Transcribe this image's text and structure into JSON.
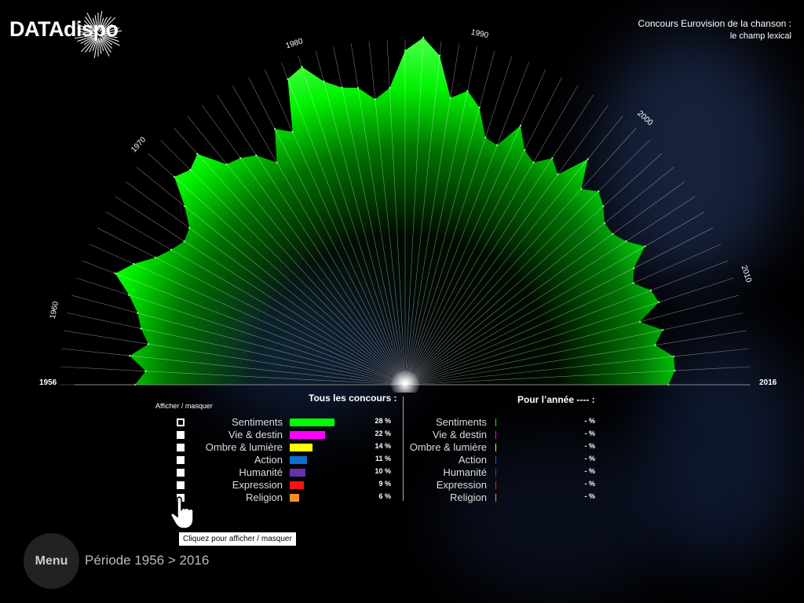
{
  "brand": "DATAdispo",
  "header": {
    "title": "Concours Eurovision de la chanson :",
    "subtitle": "le champ lexical"
  },
  "legend": {
    "toggle_heading": "Afficher / masquer",
    "all_heading": "Tous les concours :",
    "year_heading": "Pour l’année ---- :",
    "tooltip": "Cliquez pour afficher / masquer",
    "categories": [
      {
        "label": "Sentiments",
        "pct": "28 %",
        "value": 28,
        "color": "#00ff00",
        "year_pct": "- %"
      },
      {
        "label": "Vie & destin",
        "pct": "22 %",
        "value": 22,
        "color": "#ff00ff",
        "year_pct": "- %"
      },
      {
        "label": "Ombre & lumière",
        "pct": "14 %",
        "value": 14,
        "color": "#ffff00",
        "year_pct": "- %"
      },
      {
        "label": "Action",
        "pct": "11 %",
        "value": 11,
        "color": "#0a6fd1",
        "year_pct": "- %"
      },
      {
        "label": "Humanité",
        "pct": "10 %",
        "value": 10,
        "color": "#6a2fb0",
        "year_pct": "- %"
      },
      {
        "label": "Expression",
        "pct": "9 %",
        "value": 9,
        "color": "#ff1010",
        "year_pct": "- %"
      },
      {
        "label": "Religion",
        "pct": "6 %",
        "value": 6,
        "color": "#ff9020",
        "year_pct": "- %"
      }
    ]
  },
  "footer": {
    "menu_label": "Menu",
    "period": "Période 1956 > 2016"
  },
  "chart_data": {
    "type": "area",
    "layout": "radial-half",
    "series": [
      {
        "color": "#00ff00"
      }
    ],
    "year_range": [
      1956,
      2016
    ],
    "tick_labels": [
      "1956",
      "1960",
      "1970",
      "1980",
      "1990",
      "2000",
      "2010",
      "2016"
    ],
    "tick_years": [
      1956,
      1960,
      1970,
      1980,
      1990,
      2000,
      2010,
      2016
    ],
    "x": [
      1956,
      1957,
      1958,
      1959,
      1960,
      1961,
      1962,
      1963,
      1964,
      1965,
      1966,
      1967,
      1968,
      1969,
      1970,
      1971,
      1972,
      1973,
      1974,
      1975,
      1976,
      1977,
      1978,
      1979,
      1980,
      1981,
      1982,
      1983,
      1984,
      1985,
      1986,
      1987,
      1988,
      1989,
      1990,
      1991,
      1992,
      1993,
      1994,
      1995,
      1996,
      1997,
      1998,
      1999,
      2000,
      2001,
      2002,
      2003,
      2004,
      2005,
      2006,
      2007,
      2008,
      2009,
      2010,
      2011,
      2012,
      2013,
      2014,
      2015,
      2016
    ],
    "values": [
      0.8,
      0.77,
      0.82,
      0.77,
      0.8,
      0.82,
      0.86,
      0.92,
      0.88,
      0.83,
      0.8,
      0.78,
      0.79,
      0.84,
      0.92,
      0.9,
      0.92,
      0.84,
      0.83,
      0.81,
      0.76,
      0.85,
      0.82,
      0.97,
      0.99,
      0.93,
      0.9,
      0.89,
      0.85,
      0.88,
      0.99,
      1.03,
      0.98,
      0.86,
      0.89,
      0.85,
      0.77,
      0.76,
      0.84,
      0.78,
      0.76,
      0.8,
      0.77,
      0.86,
      0.78,
      0.81,
      0.79,
      0.76,
      0.76,
      0.78,
      0.82,
      0.76,
      0.74,
      0.78,
      0.79,
      0.72,
      0.78,
      0.75,
      0.8,
      0.8,
      0.78
    ]
  }
}
